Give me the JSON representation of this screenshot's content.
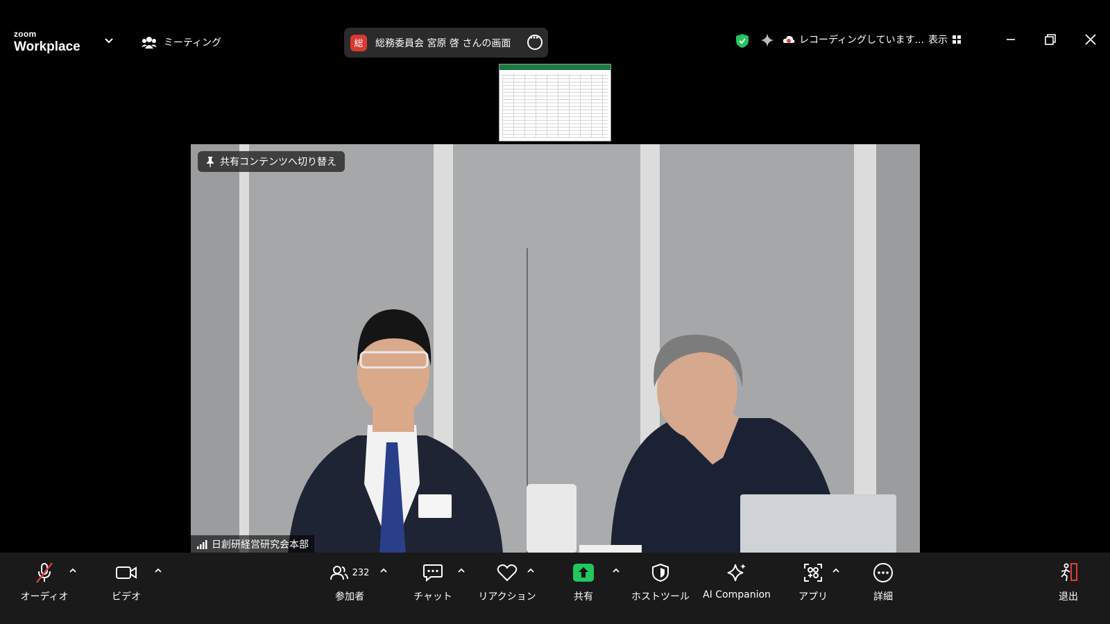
{
  "app": {
    "brand_top": "zoom",
    "brand_main": "Workplace"
  },
  "header": {
    "meeting_label": "ミーティング",
    "share_badge": "総",
    "share_title": "総務委員会 宮原 啓 さんの画面",
    "recording_text": "レコーディングしています...",
    "view_label": "表示"
  },
  "video": {
    "pin_label": "共有コンテンツへ切り替え",
    "participant_name": "日創研経営研究会本部"
  },
  "toolbar": {
    "audio": "オーディオ",
    "video": "ビデオ",
    "participants": "参加者",
    "participants_count": "232",
    "chat": "チャット",
    "reactions": "リアクション",
    "share": "共有",
    "host_tools": "ホストツール",
    "ai_companion": "AI Companion",
    "apps": "アプリ",
    "more": "詳細",
    "leave": "退出"
  },
  "colors": {
    "share_green": "#22c55e",
    "shield_green": "#22c55e",
    "badge_red": "#d83a33",
    "leave_red": "#e23b3b",
    "mute_red": "#e23b3b"
  },
  "icons": [
    "chevron-down-icon",
    "people-icon",
    "more-dots-icon",
    "shield-check-icon",
    "sparkle-icon",
    "cloud-record-icon",
    "grid-view-icon",
    "minimize-icon",
    "restore-icon",
    "close-icon",
    "pin-icon",
    "signal-icon",
    "mic-muted-icon",
    "camera-icon",
    "participants-icon",
    "chat-icon",
    "heart-icon",
    "share-up-icon",
    "host-shield-icon",
    "ai-sparkle-icon",
    "apps-icon",
    "leave-icon"
  ]
}
